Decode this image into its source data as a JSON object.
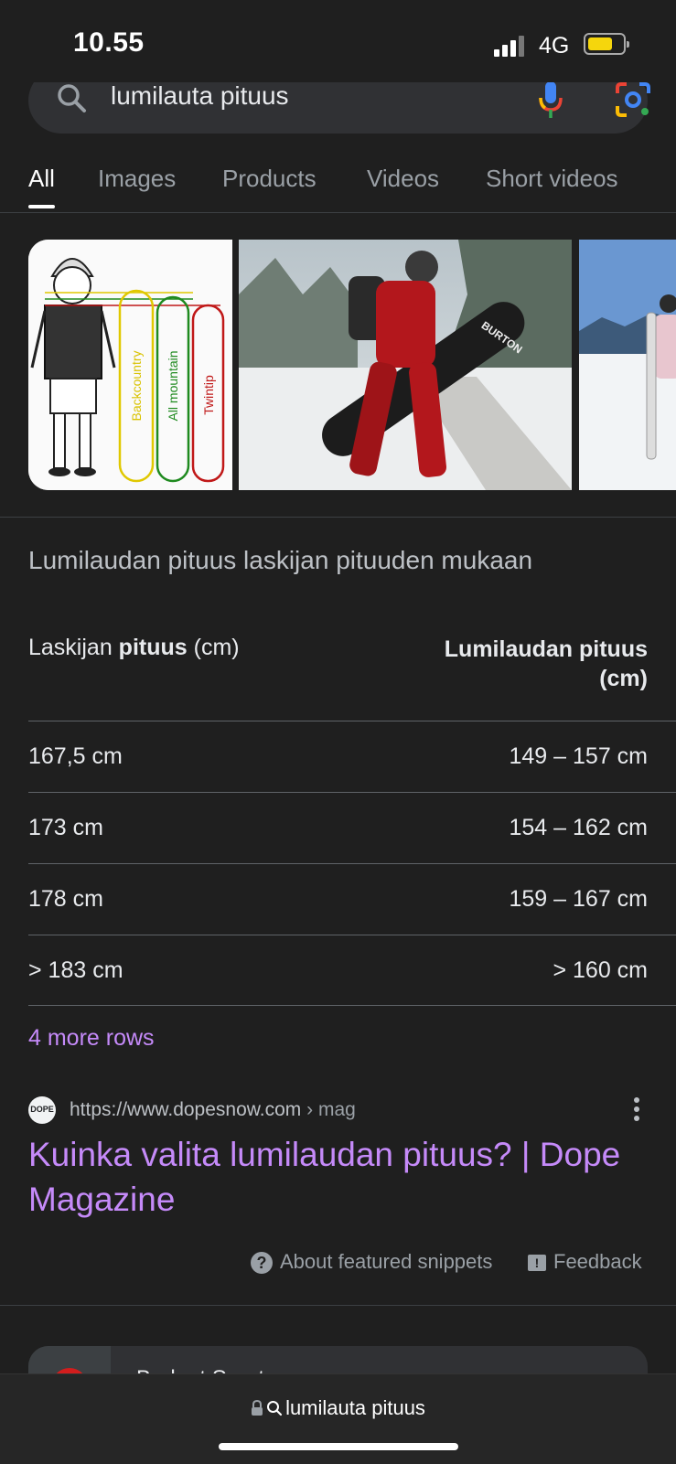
{
  "status": {
    "time": "10.55",
    "network": "4G"
  },
  "search": {
    "query": "lumilauta pituus"
  },
  "tabs": [
    {
      "label": "All",
      "active": true
    },
    {
      "label": "Images"
    },
    {
      "label": "Products"
    },
    {
      "label": "Videos"
    },
    {
      "label": "Short videos"
    }
  ],
  "images": {
    "chart_labels": [
      "Backcountry",
      "All mountain",
      "Twintip"
    ],
    "board_brand": "BURTON"
  },
  "snippet": {
    "title": "Lumilaudan pituus laskijan pituuden mukaan",
    "header_left_pre": "Laskijan ",
    "header_left_bold": "pituus",
    "header_left_post": " (cm)",
    "header_right_line1": "Lumilaudan pituus",
    "header_right_line2": "(cm)",
    "rows": [
      {
        "rider": "167,5 cm",
        "board": "149 – 157 cm"
      },
      {
        "rider": "173 cm",
        "board": "154 – 162 cm"
      },
      {
        "rider": "178 cm",
        "board": "159 – 167 cm"
      },
      {
        "rider": "> 183 cm",
        "board": "> 160 cm"
      }
    ],
    "more_rows": "4 more rows"
  },
  "result": {
    "favicon_text": "DOPE",
    "url": "https://www.dopesnow.com",
    "breadcrumb": " › mag",
    "title": "Kuinka valita lumilaudan pituus? | Dope Magazine"
  },
  "footer_links": {
    "about": "About featured snippets",
    "feedback": "Feedback"
  },
  "next_card": {
    "name": "Budget Sport"
  },
  "bottom_bar": {
    "url": "lumilauta pituus"
  },
  "colors": {
    "background": "#1f1f1f",
    "link_visited": "#c58af9",
    "surface": "#303134"
  }
}
